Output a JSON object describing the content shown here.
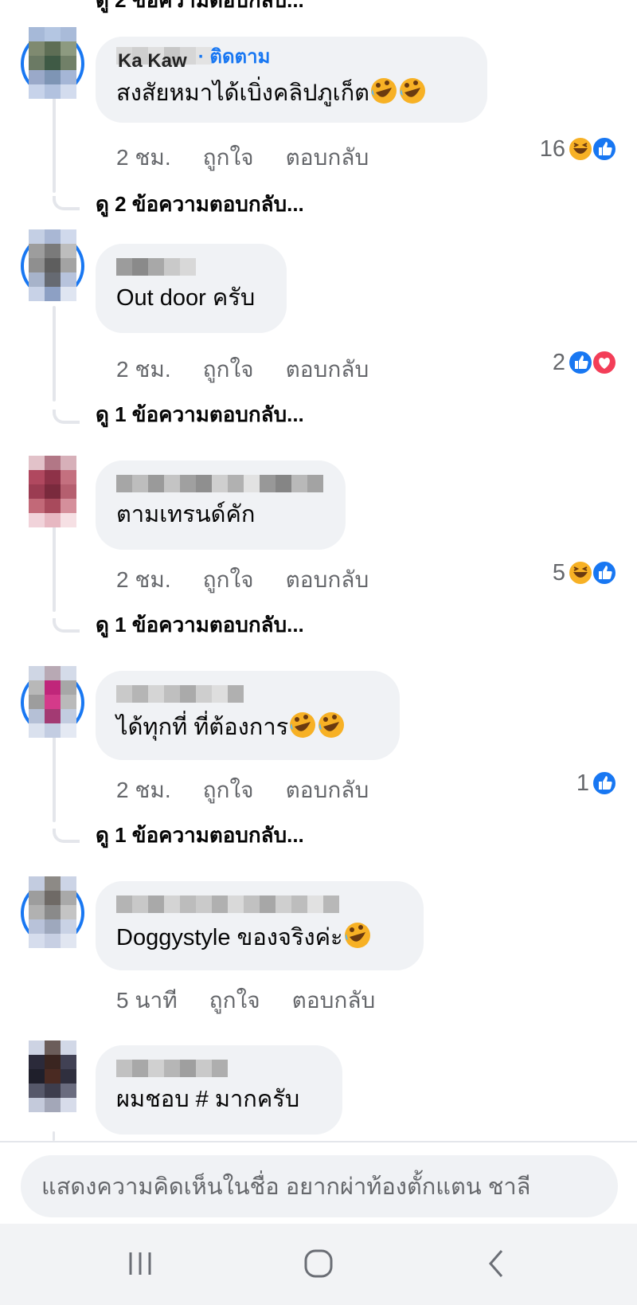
{
  "top_cut_text": "ดู 2 ข้อความตอบกลับ...",
  "comments": [
    {
      "author_visible": "Ka Kaw",
      "follow_label": "· ติดตาม",
      "text": "สงสัยหมาได้เบิ่งคลิปภูเก็ต",
      "emoji_count": 2,
      "time": "2 ชม.",
      "like_label": "ถูกใจ",
      "reply_label": "ตอบกลับ",
      "reaction_count": "16",
      "reaction_icons": [
        "haha-icon",
        "like-icon"
      ],
      "view_replies": "ดู 2 ข้อความตอบกลับ..."
    },
    {
      "text": "Out door ครับ",
      "time": "2 ชม.",
      "like_label": "ถูกใจ",
      "reply_label": "ตอบกลับ",
      "reaction_count": "2",
      "reaction_icons": [
        "like-icon",
        "love-icon"
      ],
      "view_replies": "ดู 1 ข้อความตอบกลับ..."
    },
    {
      "text": "ตามเทรนด์คัก",
      "time": "2 ชม.",
      "like_label": "ถูกใจ",
      "reply_label": "ตอบกลับ",
      "reaction_count": "5",
      "reaction_icons": [
        "haha-icon",
        "like-icon"
      ],
      "view_replies": "ดู 1 ข้อความตอบกลับ..."
    },
    {
      "text": "ได้ทุกที่ ที่ต้องการ",
      "emoji_count": 2,
      "time": "2 ชม.",
      "like_label": "ถูกใจ",
      "reply_label": "ตอบกลับ",
      "reaction_count": "1",
      "reaction_icons": [
        "like-icon"
      ],
      "view_replies": "ดู 1 ข้อความตอบกลับ..."
    },
    {
      "text": "Doggystyle ของจริงค่ะ",
      "emoji_count": 1,
      "time": "5 นาที",
      "like_label": "ถูกใจ",
      "reply_label": "ตอบกลับ"
    },
    {
      "text": "ผมชอบ # มากครับ"
    }
  ],
  "composer": {
    "placeholder": "แสดงความคิดเห็นในชื่อ อยากผ่าท้องตั้กแตน ชาลี"
  },
  "nav": {
    "buttons": [
      "recent-apps-icon",
      "home-icon",
      "back-icon"
    ]
  },
  "colors": {
    "accent": "#1877f2",
    "bubble": "#f0f2f5",
    "secondary_text": "#65676b",
    "love": "#f33e58",
    "haha": "#f7b125"
  }
}
